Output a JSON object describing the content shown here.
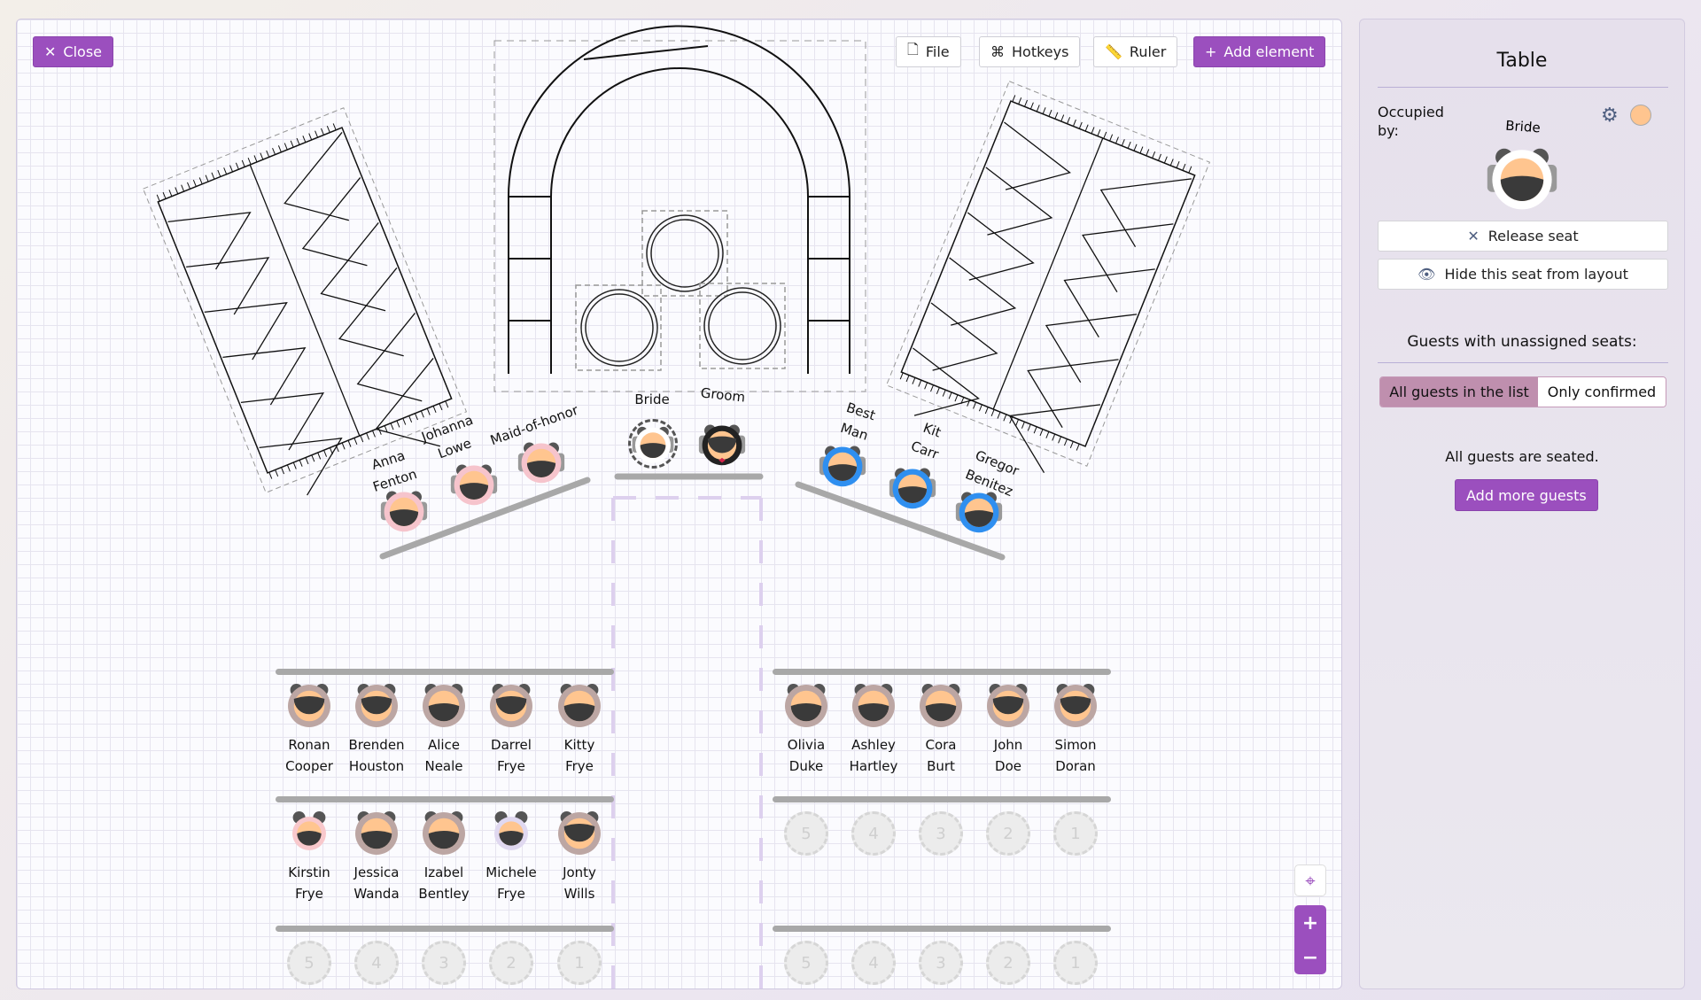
{
  "toolbar": {
    "close_label": "Close",
    "file_label": "File",
    "hotkeys_label": "Hotkeys",
    "ruler_label": "Ruler",
    "add_element_label": "Add element"
  },
  "head_party": [
    {
      "name": "Anna Fenton",
      "lines": [
        "Anna",
        "Fenton"
      ],
      "style": "pink"
    },
    {
      "name": "Johanna Lowe",
      "lines": [
        "Johanna",
        "Lowe"
      ],
      "style": "pink"
    },
    {
      "name": "Maid-of-honor",
      "lines": [
        "Maid-of-honor"
      ],
      "style": "pink"
    },
    {
      "name": "Bride",
      "lines": [
        "Bride"
      ],
      "style": "bride"
    },
    {
      "name": "Groom",
      "lines": [
        "Groom"
      ],
      "style": "tux"
    },
    {
      "name": "Best Man",
      "lines": [
        "Best",
        "Man"
      ],
      "style": "blue"
    },
    {
      "name": "Kit Carr",
      "lines": [
        "Kit",
        "Carr"
      ],
      "style": "blue"
    },
    {
      "name": "Gregor Benitez",
      "lines": [
        "Gregor",
        "Benitez"
      ],
      "style": "blue"
    }
  ],
  "tables": [
    {
      "rows": [
        [
          {
            "first": "Ronan",
            "last": "Cooper",
            "style": "male"
          },
          {
            "first": "Brenden",
            "last": "Houston",
            "style": "male"
          },
          {
            "first": "Alice",
            "last": "Neale",
            "style": "female"
          },
          {
            "first": "Darrel",
            "last": "Frye",
            "style": "male"
          },
          {
            "first": "Kitty",
            "last": "Frye",
            "style": "female"
          }
        ],
        [
          {
            "first": "Kirstin",
            "last": "Frye",
            "style": "child-pink"
          },
          {
            "first": "Jessica",
            "last": "Wanda",
            "style": "female"
          },
          {
            "first": "Izabel",
            "last": "Bentley",
            "style": "female"
          },
          {
            "first": "Michele",
            "last": "Frye",
            "style": "child-lilac"
          },
          {
            "first": "Jonty",
            "last": "Wills",
            "style": "male"
          }
        ],
        [
          "5",
          "4",
          "3",
          "2",
          "1"
        ]
      ]
    },
    {
      "rows": [
        [
          {
            "first": "Olivia",
            "last": "Duke",
            "style": "female"
          },
          {
            "first": "Ashley",
            "last": "Hartley",
            "style": "female"
          },
          {
            "first": "Cora",
            "last": "Burt",
            "style": "female"
          },
          {
            "first": "John",
            "last": "Doe",
            "style": "male"
          },
          {
            "first": "Simon",
            "last": "Doran",
            "style": "male"
          }
        ],
        [
          "5",
          "4",
          "3",
          "2",
          "1"
        ],
        [
          "5",
          "4",
          "3",
          "2",
          "1"
        ]
      ]
    }
  ],
  "panel": {
    "title": "Table",
    "occupied_label": "Occupied by:",
    "occupant": "Bride",
    "seat_color": "#ffc58f",
    "release_label": "Release seat",
    "hide_label": "Hide this seat from layout",
    "unassigned_heading": "Guests with unassigned seats:",
    "filter_all": "All guests in the list",
    "filter_confirmed": "Only confirmed",
    "filter_selected": "All guests in the list",
    "status": "All guests are seated.",
    "add_guests_label": "Add more guests"
  },
  "colors": {
    "accent": "#9b4fbe",
    "pink": "#f6c4cc",
    "blue": "#2f8ff0",
    "skin": "#ffc58f",
    "hair": "#3a3a3a",
    "guest": "#bca6a3"
  }
}
